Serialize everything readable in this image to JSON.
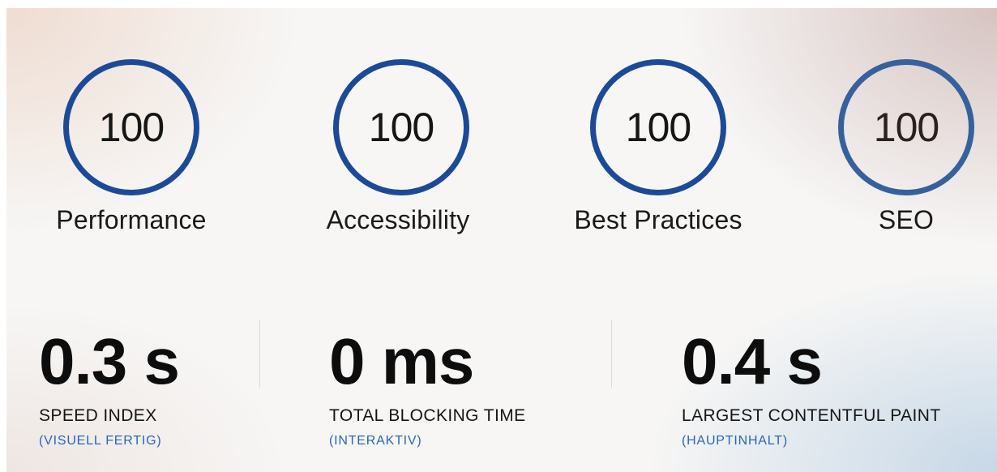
{
  "colors": {
    "gauge_ring": "#1c4a98",
    "gauge_ring_seo": "#36619c",
    "seo_value_text": "#2b211c",
    "sub_label": "#2a66b6"
  },
  "scores": [
    {
      "value": "100",
      "label": "Performance"
    },
    {
      "value": "100",
      "label": "Accessibility"
    },
    {
      "value": "100",
      "label": "Best Practices"
    },
    {
      "value": "100",
      "label": "SEO"
    }
  ],
  "metrics": [
    {
      "value": "0.3 s",
      "title": "SPEED INDEX",
      "subtitle": "(VISUELL FERTIG)"
    },
    {
      "value": "0 ms",
      "title": "TOTAL BLOCKING TIME",
      "subtitle": "(INTERAKTIV)"
    },
    {
      "value": "0.4 s",
      "title": "LARGEST CONTENTFUL PAINT",
      "subtitle": "(HAUPTINHALT)"
    }
  ]
}
